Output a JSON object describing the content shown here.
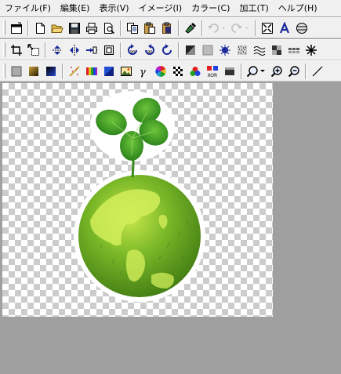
{
  "menubar": {
    "items": [
      {
        "label": "ファイル(F)"
      },
      {
        "label": "編集(E)"
      },
      {
        "label": "表示(V)"
      },
      {
        "label": "イメージ(I)"
      },
      {
        "label": "カラー(C)"
      },
      {
        "label": "加工(T)"
      },
      {
        "label": "ヘルプ(H)"
      }
    ]
  },
  "toolbar1": {
    "icons": [
      "window-icon",
      "new-file-icon",
      "open-folder-icon",
      "save-icon",
      "print-icon",
      "print-preview-icon",
      "copy-icon",
      "paste-icon",
      "paste-new-icon",
      "dropper-icon",
      "undo-icon",
      "redo-icon",
      "zoom-fit-icon",
      "text-icon",
      "adjust-icon"
    ]
  },
  "toolbar2": {
    "icons": [
      "crop-icon",
      "resize-icon",
      "flip-vertical-icon",
      "flip-horizontal-icon",
      "center-icon",
      "frame-icon",
      "rotate-90-left-icon",
      "rotate-90-right-icon",
      "rotate-icon",
      "emboss-icon",
      "blur-icon",
      "sharpen-icon",
      "noise-icon",
      "wave-icon",
      "mosaic-icon",
      "dots-icon",
      "sparkle-icon"
    ]
  },
  "toolbar3": {
    "icons": [
      "gray-square-icon",
      "gradient-square-icon",
      "dark-gradient-icon",
      "fade-icon",
      "color-bars-icon",
      "blue-square-icon",
      "picture-icon",
      "gamma-icon",
      "color-wheel-icon",
      "checker-icon",
      "rgb-icon",
      "xor-icon",
      "monochrome-icon",
      "magnifier-dropdown-icon",
      "zoom-in-icon",
      "zoom-out-icon",
      "line-tool-icon"
    ]
  },
  "colors": {
    "menubar_bg": "#f0f0f0",
    "workspace_bg": "#a0a0a0",
    "checker_dark": "#cccccc",
    "checker_light": "#ffffff",
    "leaf_green": "#3f9a1e",
    "globe_green": "#6fae1a"
  }
}
